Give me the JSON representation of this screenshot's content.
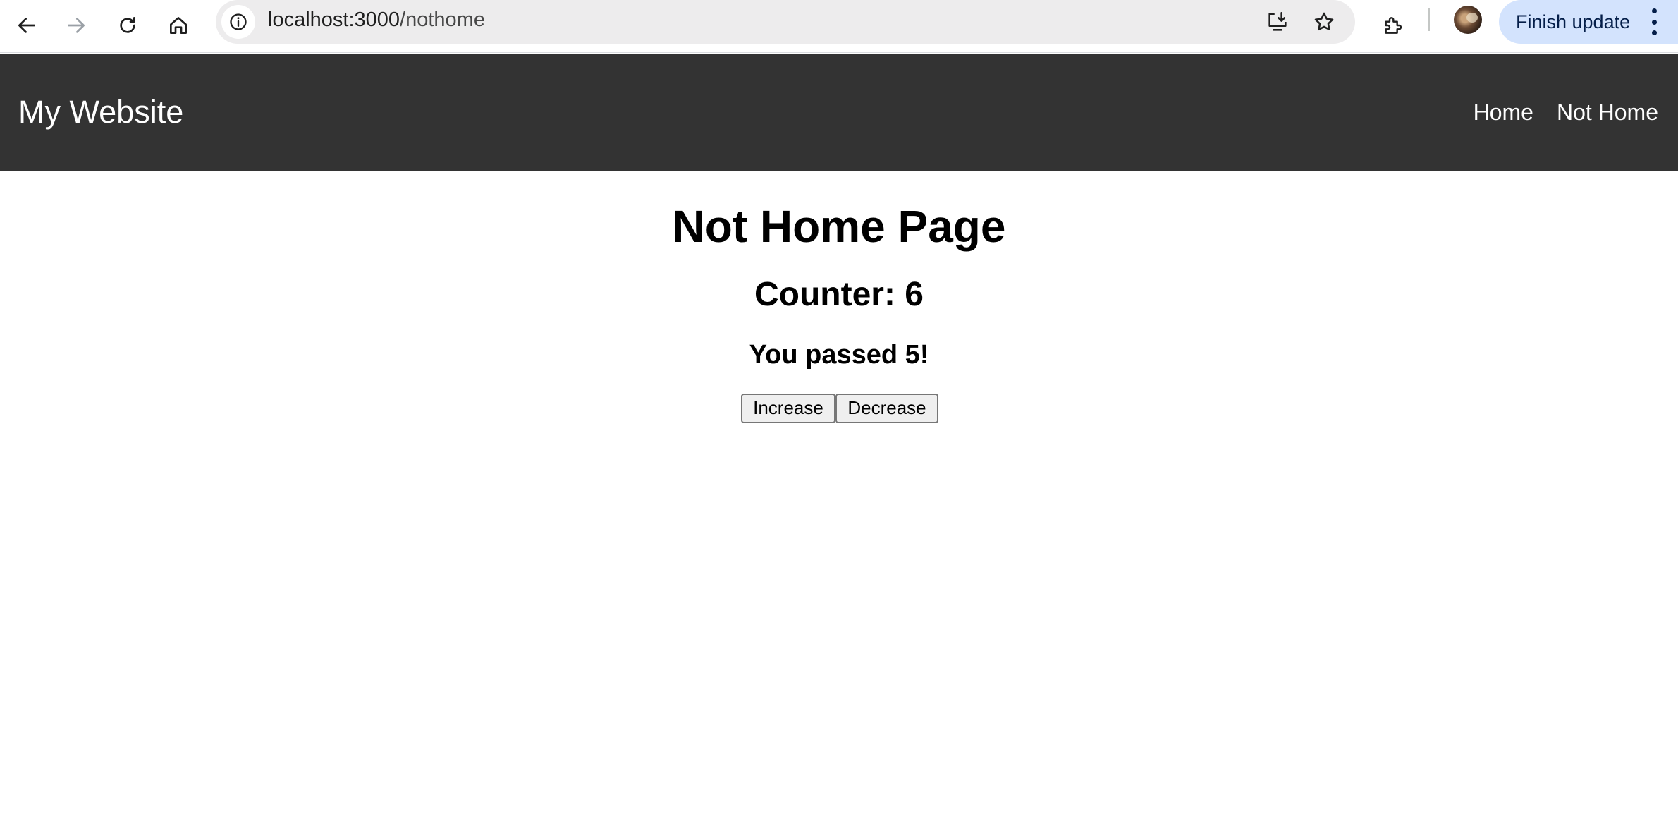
{
  "browser": {
    "url_host": "localhost:3000",
    "url_path": "/nothome",
    "toolbar_icons": [
      "back-icon",
      "forward-icon",
      "reload-icon",
      "home-icon",
      "info-icon",
      "install-app-icon",
      "bookmark-star-icon",
      "extensions-icon",
      "profile-avatar"
    ],
    "update_label": "Finish update",
    "update_chip_color": "#d3e3fd"
  },
  "header": {
    "brand": "My Website",
    "background": "#333333",
    "nav": [
      {
        "label": "Home"
      },
      {
        "label": "Not Home"
      }
    ]
  },
  "main": {
    "title": "Not Home Page",
    "counter_text": "Counter: 6",
    "passed_text": "You passed 5!",
    "buttons": {
      "increase": "Increase",
      "decrease": "Decrease"
    }
  }
}
